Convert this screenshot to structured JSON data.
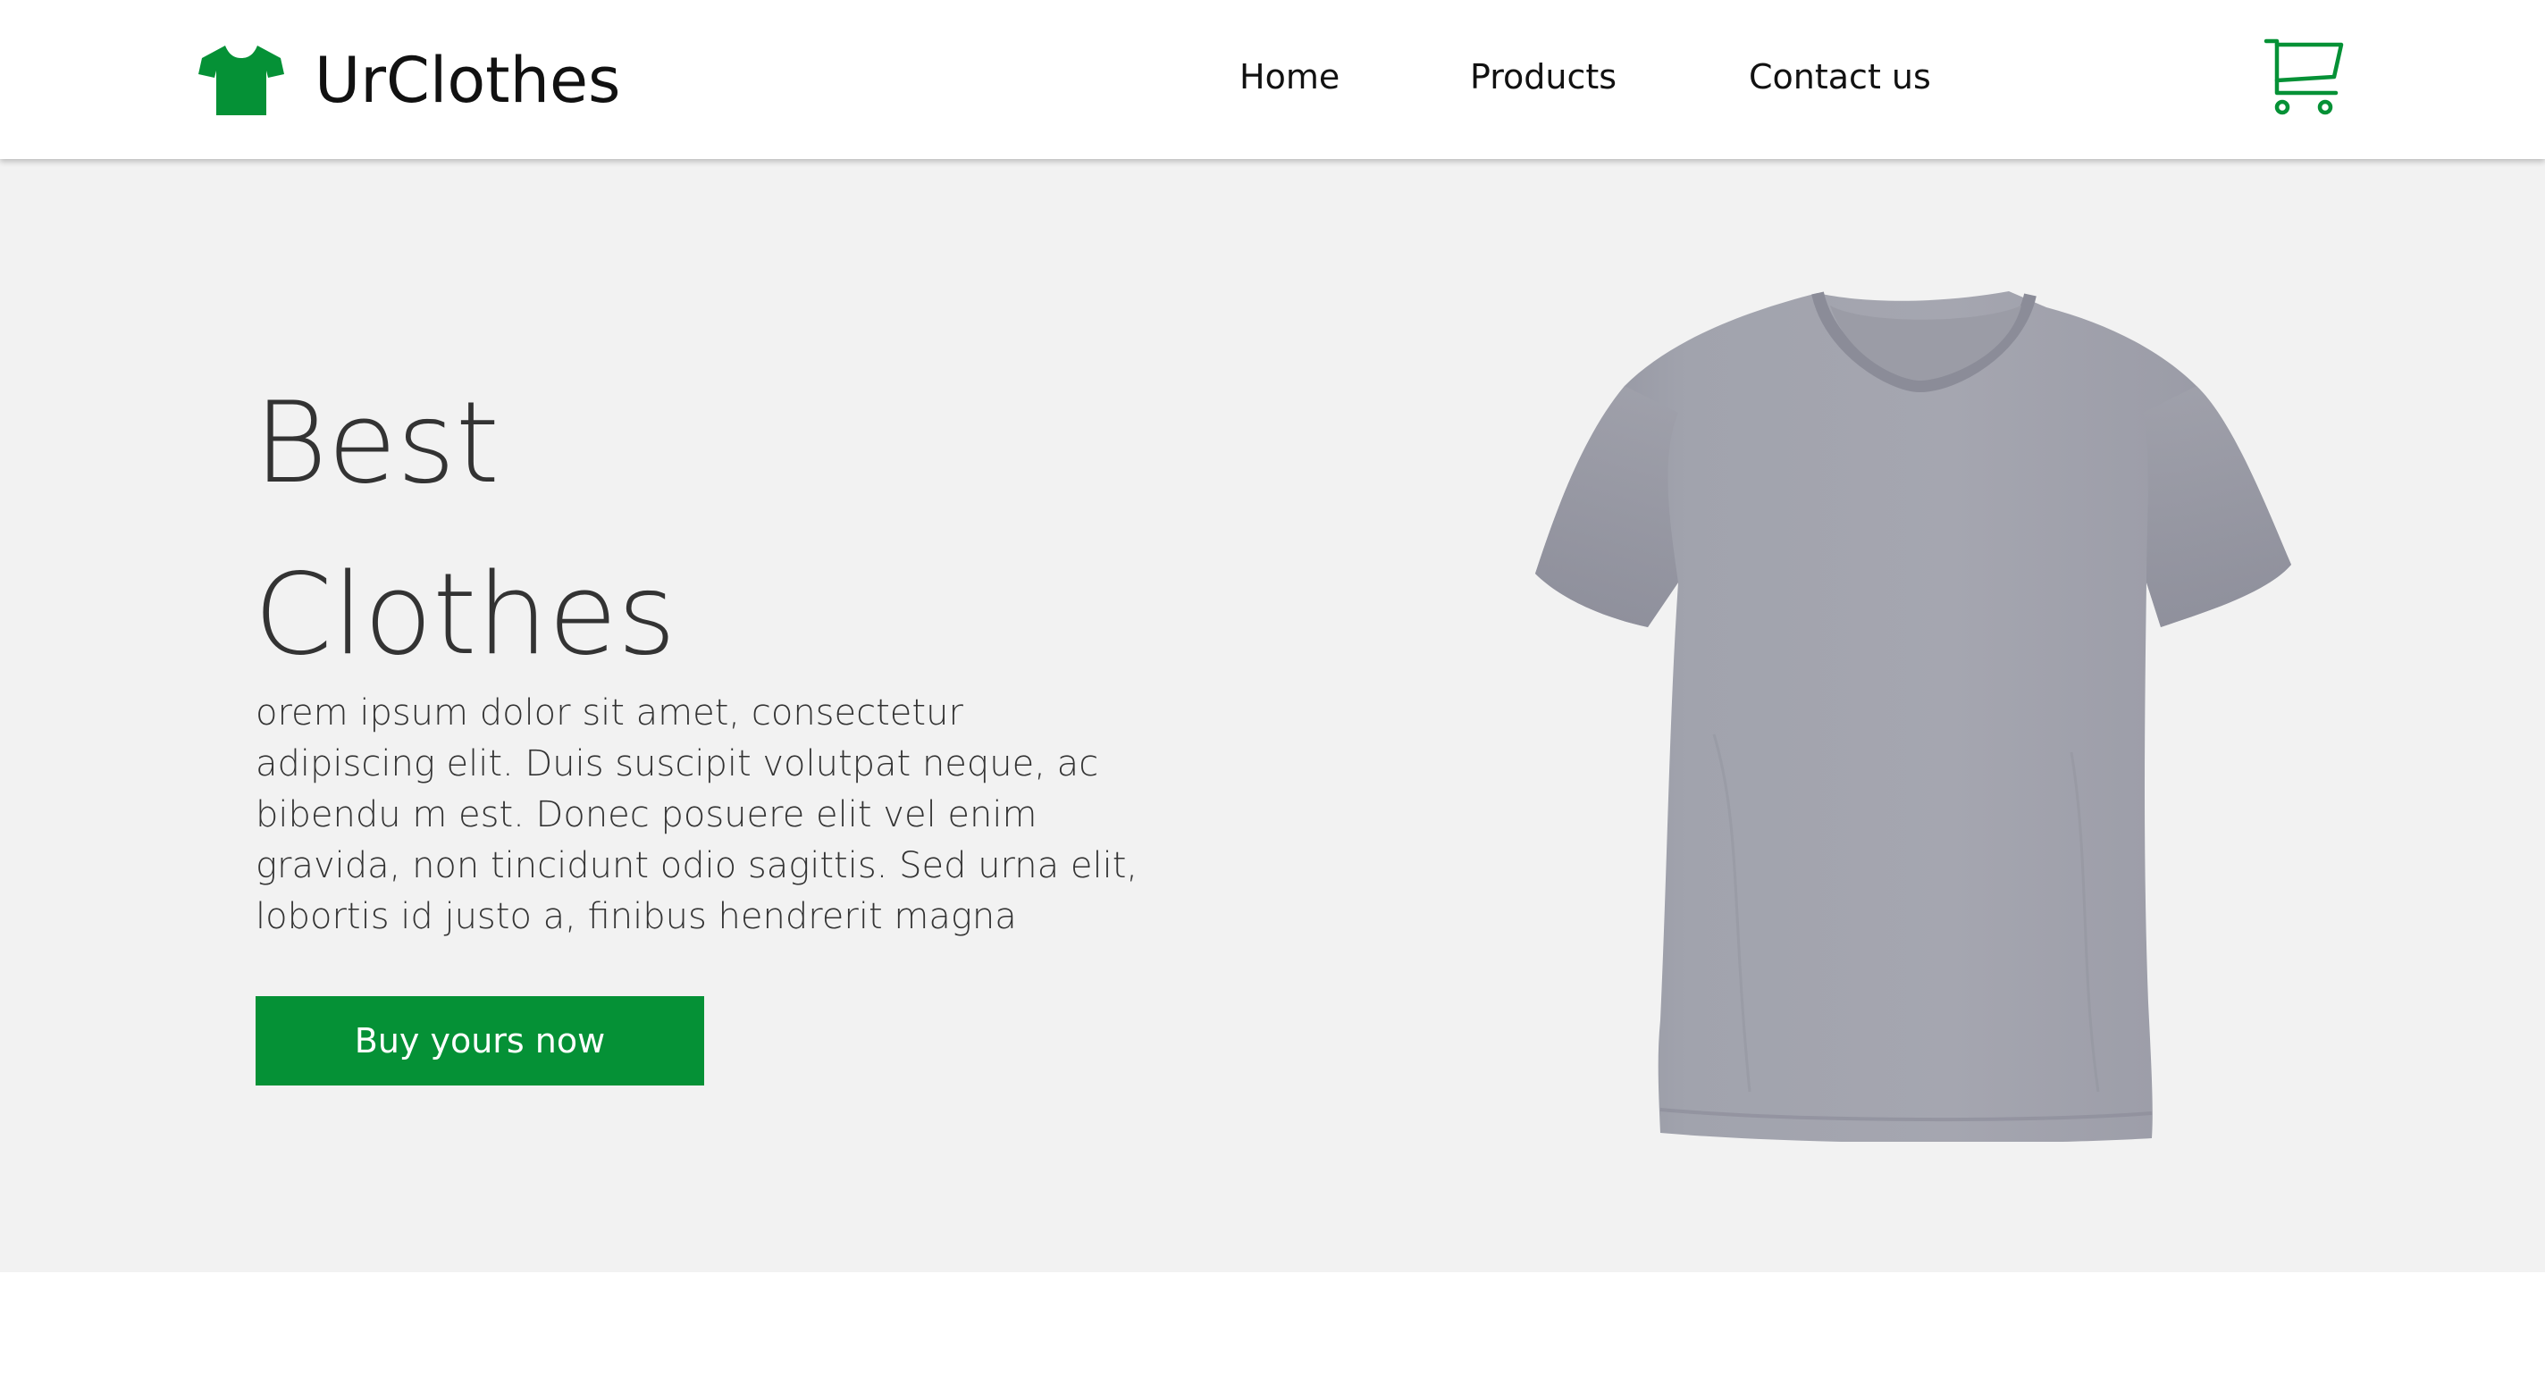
{
  "brand": {
    "name": "UrClothes",
    "icon": "tshirt-icon",
    "accent_color": "#059136"
  },
  "nav": {
    "items": [
      {
        "label": "Home"
      },
      {
        "label": "Products"
      },
      {
        "label": "Contact us"
      }
    ],
    "cart_icon": "cart-icon"
  },
  "hero": {
    "title_line1": "Best",
    "title_line2": "Clothes",
    "description": "orem ipsum dolor sit amet, consectetur adipiscing elit. Duis suscipit volutpat neque, ac bibendu m est. Donec posuere elit vel enim gravida, non tincidunt odio sagittis. Sed urna elit, lobortis id justo a, finibus hendrerit magna",
    "cta_label": "Buy yours now",
    "cta_color": "#059136",
    "background": "#f2f2f2",
    "product_image": "grey-tshirt-image"
  }
}
